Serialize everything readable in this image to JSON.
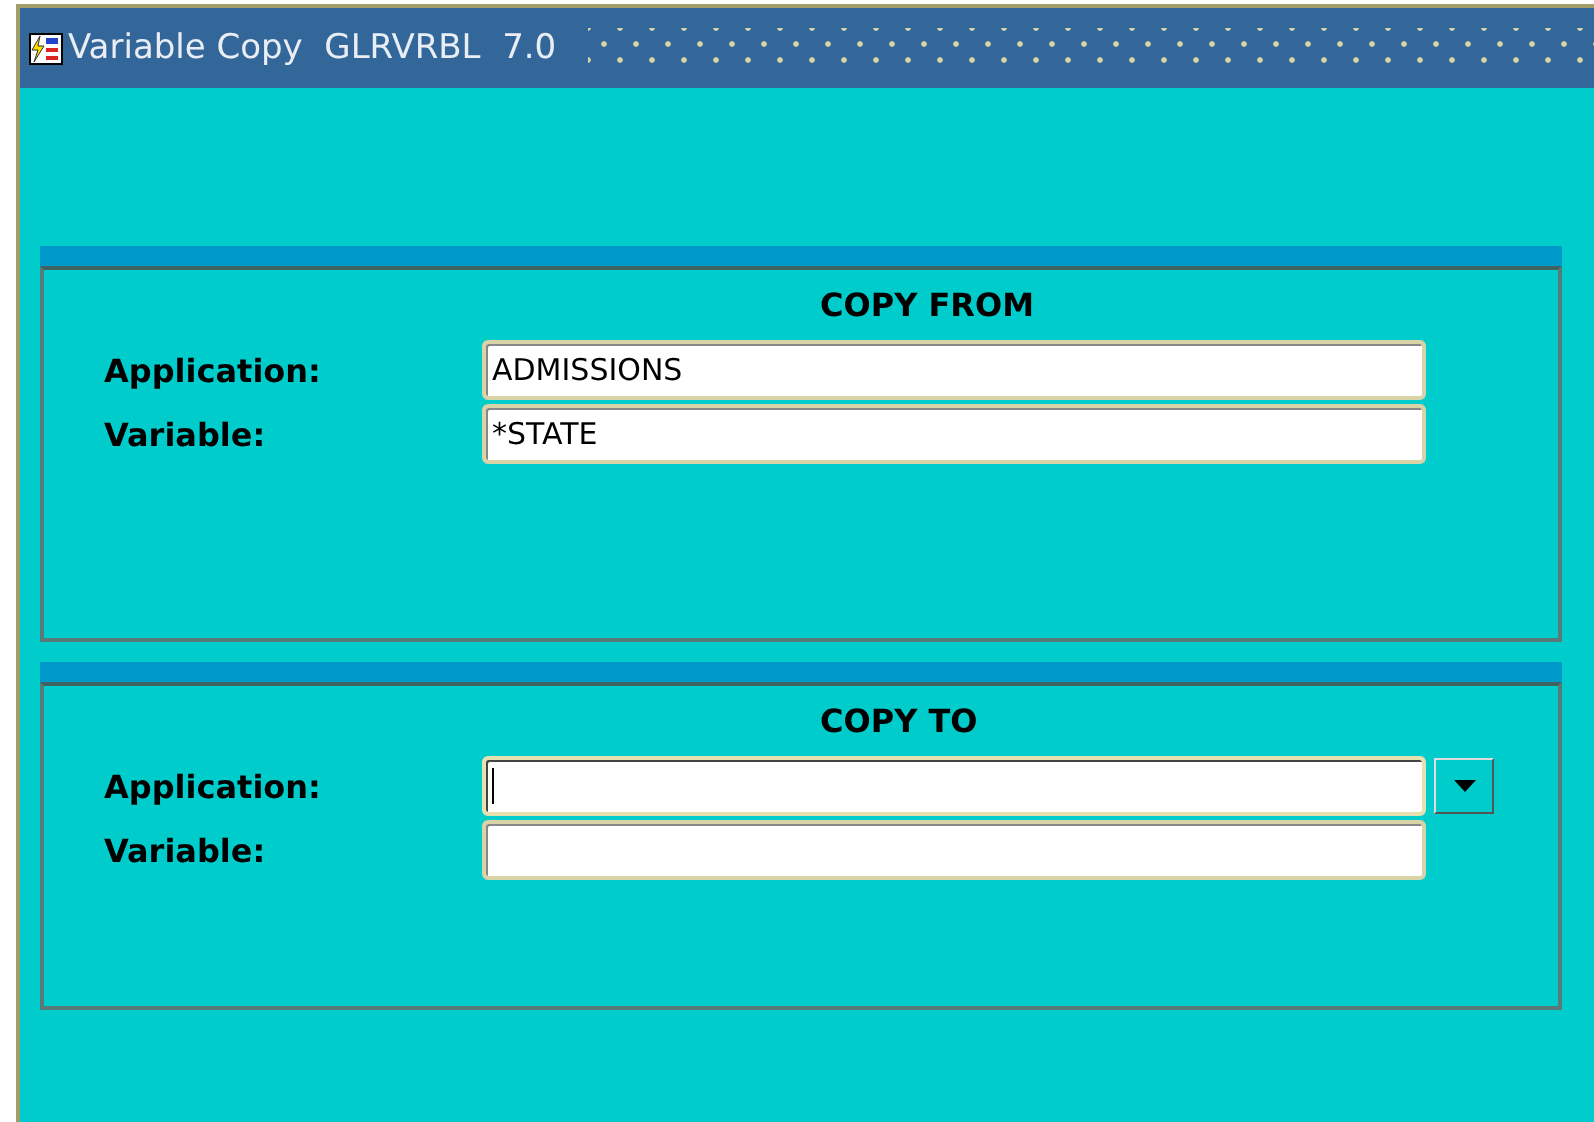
{
  "window": {
    "title": "Variable Copy  GLRVRBL  7.0"
  },
  "sections": [
    {
      "heading": "COPY FROM",
      "fields": [
        {
          "label": "Application:",
          "value": "ADMISSIONS",
          "focused": false,
          "dropdown": false
        },
        {
          "label": "Variable:",
          "value": "*STATE",
          "focused": false,
          "dropdown": false
        }
      ]
    },
    {
      "heading": "COPY TO",
      "fields": [
        {
          "label": "Application:",
          "focused": true,
          "dropdown": true
        },
        {
          "label": "Variable:",
          "focused": false,
          "dropdown": false
        }
      ]
    }
  ]
}
